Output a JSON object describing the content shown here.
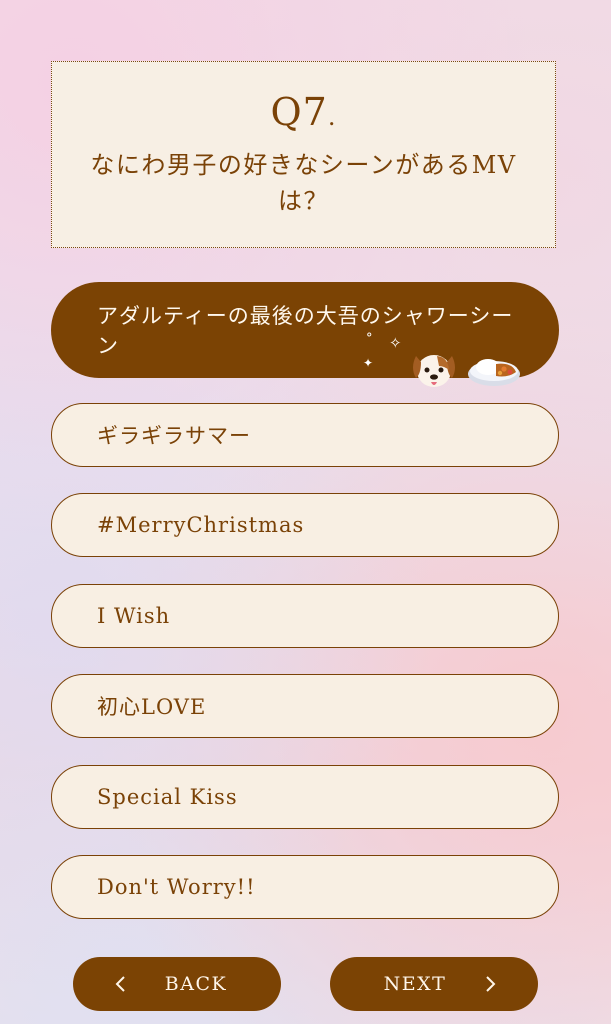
{
  "question": {
    "number": "Q7",
    "number_suffix": ".",
    "text": "なにわ男子の好きなシーンがあるMVは？"
  },
  "options": [
    {
      "label": "アダルティーの最後の大吾のシャワーシーン",
      "selected": true
    },
    {
      "label": "ギラギラサマー",
      "selected": false
    },
    {
      "label": "#MerryChristmas",
      "selected": false
    },
    {
      "label": "I Wish",
      "selected": false
    },
    {
      "label": "初心LOVE",
      "selected": false
    },
    {
      "label": "Special Kiss",
      "selected": false
    },
    {
      "label": "Don't Worry!!",
      "selected": false
    }
  ],
  "decorations": {
    "icons": [
      "sparkle-icon",
      "dog-emoji",
      "curry-rice-emoji"
    ]
  },
  "nav": {
    "back_label": "BACK",
    "next_label": "NEXT"
  },
  "colors": {
    "accent": "#7b4304",
    "card": "#f8efe3"
  }
}
